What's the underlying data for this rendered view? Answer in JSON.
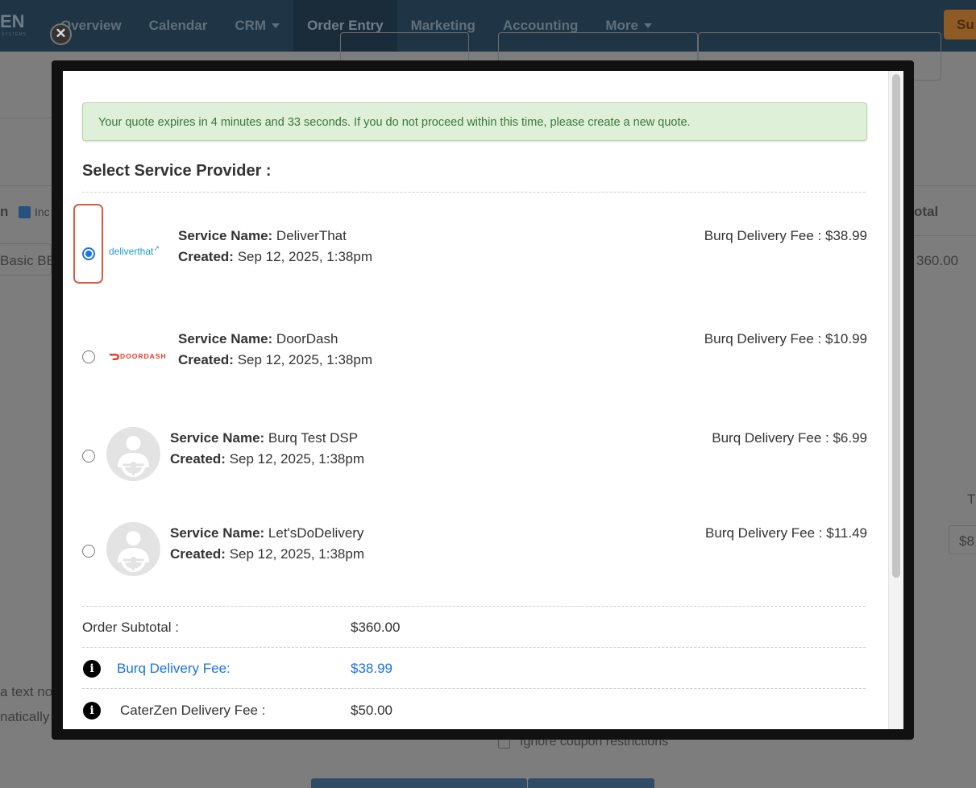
{
  "app": {
    "brand_text": "EN",
    "brand_sub": "SYSTEMS",
    "nav": [
      {
        "label": "Overview",
        "has_caret": false
      },
      {
        "label": "Calendar",
        "has_caret": false
      },
      {
        "label": "CRM",
        "has_caret": true
      },
      {
        "label": "Order Entry",
        "has_caret": false,
        "active": true
      },
      {
        "label": "Marketing",
        "has_caret": false
      },
      {
        "label": "Accounting",
        "has_caret": false
      },
      {
        "label": "More",
        "has_caret": true
      }
    ],
    "nav_button_label": "Su",
    "bg_left_label": "n",
    "bg_checkbox_label": "Inc",
    "bg_item_text": "Basic BB",
    "bg_col_total": "otal",
    "bg_row_total": "360.00",
    "bg_t_label": "T",
    "bg_input_value": "$8",
    "bg_text_line1": "a text no",
    "bg_text_line2": "natically",
    "bg_ignore_coupon": "Ignore coupon restrictions"
  },
  "modal": {
    "close_icon": "close-icon",
    "alert_text": "Your quote expires in 4 minutes and 33 seconds. If you do not proceed within this time, please create a new quote.",
    "section_title": "Select Service Provider :",
    "service_name_label": "Service Name:",
    "created_label": "Created:",
    "providers": [
      {
        "service_name": "DeliverThat",
        "created": "Sep 12, 2025, 1:38pm",
        "fee_text": "Burq Delivery Fee : $38.99",
        "logo_text": "deliverthat",
        "selected": true
      },
      {
        "service_name": "DoorDash",
        "created": "Sep 12, 2025, 1:38pm",
        "fee_text": "Burq Delivery Fee : $10.99",
        "logo_text": "DOORDASH",
        "selected": false
      },
      {
        "service_name": "Burq Test DSP",
        "created": "Sep 12, 2025, 1:38pm",
        "fee_text": "Burq Delivery Fee : $6.99",
        "logo_icon": "driver-avatar-icon",
        "selected": false
      },
      {
        "service_name": "Let'sDoDelivery",
        "created": "Sep 12, 2025, 1:38pm",
        "fee_text": "Burq Delivery Fee : $11.49",
        "logo_icon": "driver-avatar-icon",
        "selected": false
      }
    ],
    "summary": {
      "subtotal_label": "Order Subtotal :",
      "subtotal_value": "$360.00",
      "burq_fee_label": "Burq Delivery Fee:",
      "burq_fee_value": "$38.99",
      "caterzen_fee_label": "CaterZen Delivery Fee :",
      "caterzen_fee_value": "$50.00",
      "info_icon": "info-icon"
    }
  },
  "colors": {
    "nav_bg": "#1f3444",
    "alert_bg": "#dff0d8",
    "alert_text": "#3c763d",
    "link_blue": "#1a73e8",
    "highlight_red": "#d95c45",
    "doordash_red": "#ea3c23",
    "deliverthat_blue": "#1b9bd7"
  }
}
